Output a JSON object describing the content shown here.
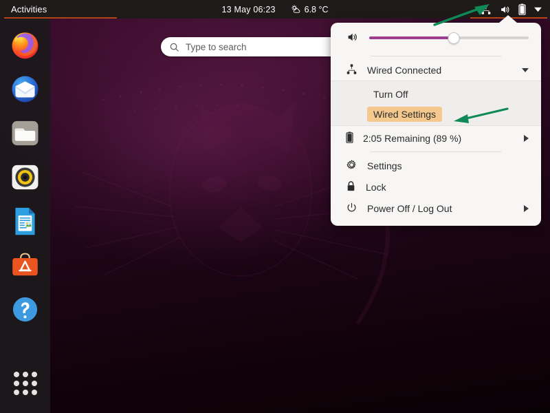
{
  "topbar": {
    "activities_label": "Activities",
    "clock": "13 May  06:23",
    "weather_temp": "6.8 °C",
    "weather_icon": "sun-behind-cloud-icon",
    "network_icon": "wired-network-icon",
    "volume_icon": "volume-high-icon",
    "battery_icon": "battery-icon",
    "chevron_icon": "chevron-down-icon"
  },
  "search": {
    "placeholder": "Type to search",
    "icon": "search-icon"
  },
  "dock": {
    "items": [
      {
        "name": "firefox",
        "label": "Firefox"
      },
      {
        "name": "thunderbird",
        "label": "Thunderbird Mail"
      },
      {
        "name": "files",
        "label": "Files"
      },
      {
        "name": "rhythmbox",
        "label": "Rhythmbox"
      },
      {
        "name": "libreoffice-writer",
        "label": "LibreOffice Writer"
      },
      {
        "name": "ubuntu-software",
        "label": "Ubuntu Software"
      },
      {
        "name": "help",
        "label": "Help"
      }
    ],
    "show_apps_label": "Show Applications"
  },
  "system_menu": {
    "volume": {
      "icon": "volume-high-icon",
      "value_percent": 53
    },
    "network": {
      "icon": "wired-network-icon",
      "label": "Wired Connected",
      "expander_icon": "chevron-down-icon",
      "submenu": [
        {
          "label": "Turn Off",
          "highlighted": false
        },
        {
          "label": "Wired Settings",
          "highlighted": true
        }
      ]
    },
    "battery": {
      "icon": "battery-icon",
      "label": "2:05 Remaining (89 %)",
      "expander_icon": "chevron-right-icon"
    },
    "actions": [
      {
        "label": "Settings",
        "icon": "gear-icon",
        "expander": false
      },
      {
        "label": "Lock",
        "icon": "lock-icon",
        "expander": false
      },
      {
        "label": "Power Off / Log Out",
        "icon": "power-icon",
        "expander": true
      }
    ]
  },
  "annotations": {
    "arrow_color": "#0f8a56",
    "arrow_top_target": "network-status-icon",
    "arrow_menu_target": "wired-settings-menu-item"
  }
}
